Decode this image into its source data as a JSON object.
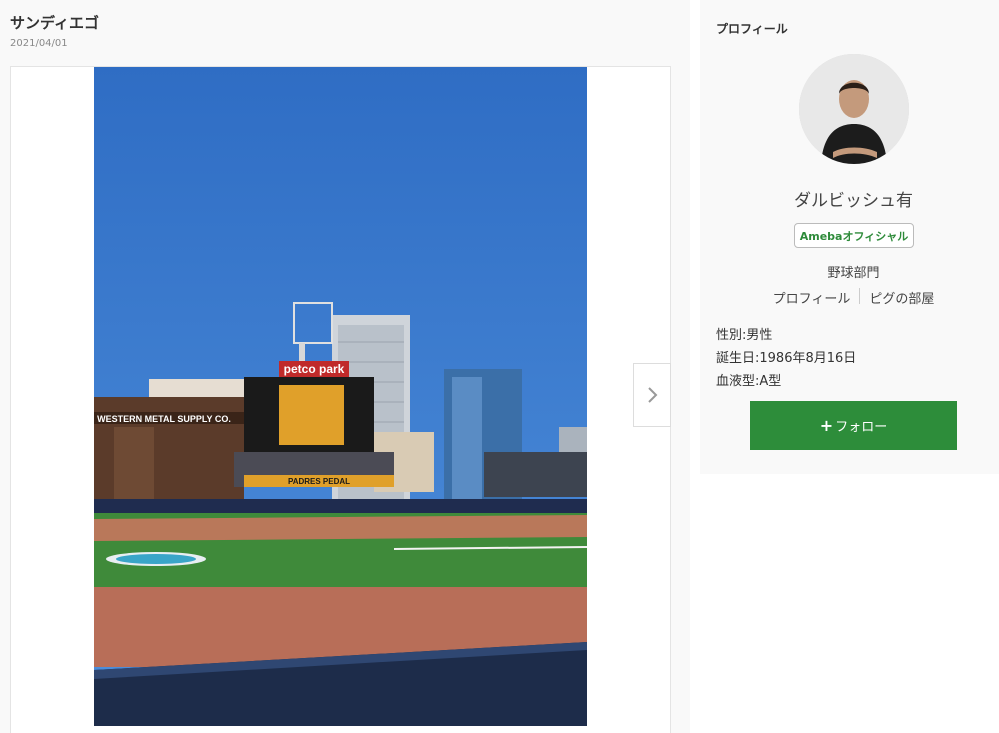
{
  "post": {
    "title": "サンディエゴ",
    "date": "2021/04/01"
  },
  "photo": {
    "stadium_sign": "petco park",
    "banner_text": "PADRES PEDAL",
    "building_sign": "WESTERN METAL SUPPLY CO."
  },
  "profile": {
    "heading": "プロフィール",
    "name": "ダルビッシュ有",
    "badge": "Amebaオフィシャル",
    "category": "野球部門",
    "links": [
      "プロフィール",
      "ピグの部屋"
    ],
    "info": {
      "gender": "性別:男性",
      "birthday": "誕生日:1986年8月16日",
      "blood_type": "血液型:A型"
    },
    "follow_plus": "+",
    "follow_label": "フォロー",
    "colors": {
      "accent_green": "#2d8d3a",
      "badge_text": "#2e8b3a"
    }
  }
}
